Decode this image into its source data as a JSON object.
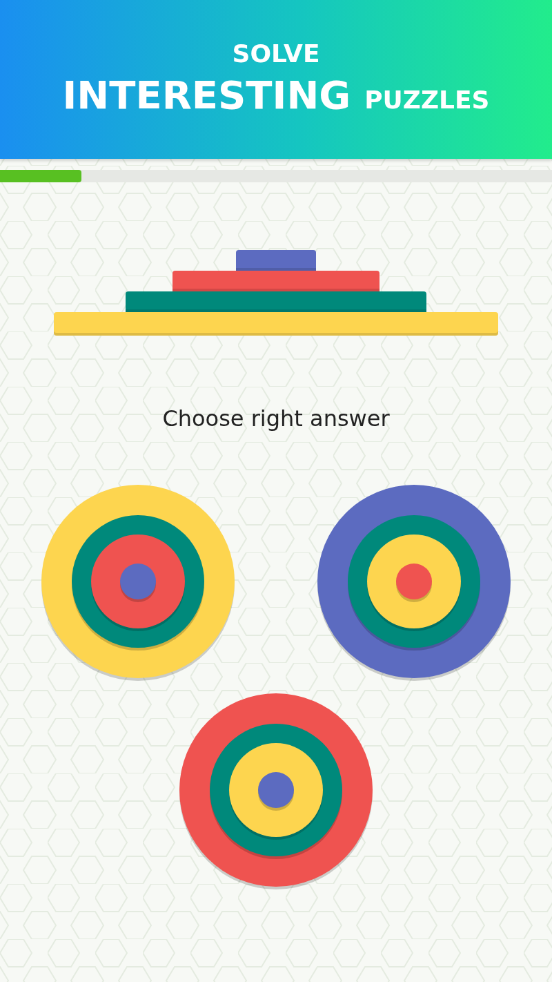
{
  "header": {
    "line_1": "SOLVE",
    "line_2_big": "INTERESTING",
    "line_2_small": "PUZZLES"
  },
  "progress": {
    "level": 0.147
  },
  "puzzle": {
    "layers": [
      {
        "color": "#5c6bc0"
      },
      {
        "color": "#ef5350"
      },
      {
        "color": "#00897b"
      },
      {
        "color": "#fdd54f"
      }
    ]
  },
  "prompt": "Choose right answer",
  "answers": [
    {
      "rings": [
        {
          "color": "#fdd54f"
        },
        {
          "color": "#00897b"
        },
        {
          "color": "#ef5350"
        },
        {
          "color": "#5c6bc0"
        }
      ]
    },
    {
      "rings": [
        {
          "color": "#5c6bc0"
        },
        {
          "color": "#00897b"
        },
        {
          "color": "#fdd54f"
        },
        {
          "color": "#ef5350"
        }
      ]
    },
    {
      "rings": [
        {
          "color": "#ef5350"
        },
        {
          "color": "#00897b"
        },
        {
          "color": "#fdd54f"
        },
        {
          "color": "#5c6bc0"
        }
      ]
    }
  ]
}
